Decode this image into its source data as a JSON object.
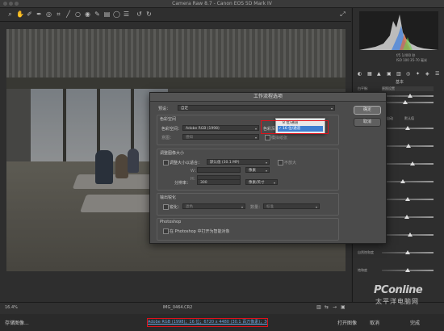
{
  "window": {
    "title": "Camera Raw 8.7 - Canon EOS 5D Mark IV"
  },
  "histogram_info": {
    "line1": "f/5   1/400 秒",
    "line2": "ISO 100   35-70 毫米"
  },
  "right_panel": {
    "section": "基本",
    "profile_label": "白平衡:",
    "profile_value": "原照设置",
    "rows": [
      "色温",
      "色调",
      "曝光",
      "对比度",
      "高光",
      "阴影",
      "白色",
      "黑色",
      "清晰度",
      "自然饱和度",
      "饱和度"
    ],
    "auto_label": "自动",
    "default_label": "默认值"
  },
  "status_bar": {
    "zoom": "16.4%",
    "filename": "IMG_0464.CR2"
  },
  "bottom": {
    "save": "存储图像...",
    "workflow_link": "Adobe RGB (1998)；16 位；6720 x 4480 (30.1 百万像素)；300 ppi",
    "open": "打开图像",
    "cancel": "取消",
    "done": "完成"
  },
  "dialog": {
    "title": "工作流程选项",
    "preset_label": "预设：",
    "preset_value": "自定",
    "ok": "确定",
    "cancel": "取消",
    "color_space": {
      "header": "色彩空间",
      "space_label": "色彩空间：",
      "space_value": "Adobe RGB (1998)",
      "depth_label": "色彩深度：",
      "depth_value": "16 位/通道",
      "intent_label": "意图：",
      "intent_value": "感知",
      "simulate_label": "模拟纸张"
    },
    "bit_popup": {
      "option1": "8 位/通道",
      "option2": "16 位/通道",
      "selected_marker": "✓"
    },
    "resize": {
      "header": "调整图像大小",
      "resize_label": "调整大小以适合：",
      "resize_value": "默认值 (30.1 MP)",
      "no_enlarge": "不放大",
      "w_label": "W：",
      "h_label": "H：",
      "unit_value": "像素",
      "res_label": "分辨率：",
      "res_value": "300",
      "res_unit": "像素/英寸"
    },
    "sharpen": {
      "header": "输出锐化",
      "sharpen_label": "锐化：",
      "sharpen_for": "滤色",
      "amount_label": "数量：",
      "amount_value": "标准"
    },
    "photoshop": {
      "header": "Photoshop",
      "smart_label": "在 Photoshop 中打开为智能对象"
    }
  },
  "watermark": {
    "brand": "PConline",
    "cn": "太平洋电脑网"
  },
  "colors": {
    "highlight": "#e0101a",
    "link": "#6ea7e0",
    "selected_option": "#3d7fd1"
  }
}
